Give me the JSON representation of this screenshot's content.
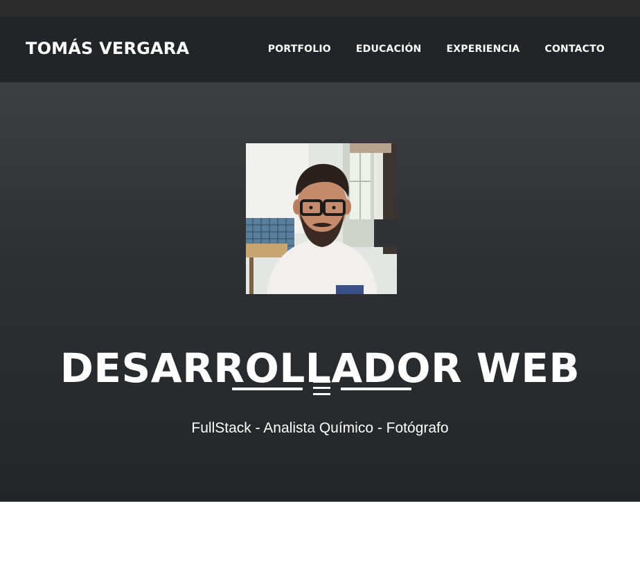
{
  "header": {
    "brand": "TOMÁS VERGARA",
    "nav": [
      {
        "label": "PORTFOLIO"
      },
      {
        "label": "EDUCACIÓN"
      },
      {
        "label": "EXPERIENCIA"
      },
      {
        "label": "CONTACTO"
      }
    ]
  },
  "hero": {
    "avatar_icon": "profile-photo",
    "title": "DESARROLLADOR WEB",
    "divider_icon": "bars-icon",
    "subtitle": "FullStack - Analista Químico - Fotógrafo"
  },
  "colors": {
    "navbar_bg": "#222428",
    "hero_bg_top": "#3c3e42",
    "hero_bg_bottom": "#232528",
    "text": "#ffffff"
  }
}
